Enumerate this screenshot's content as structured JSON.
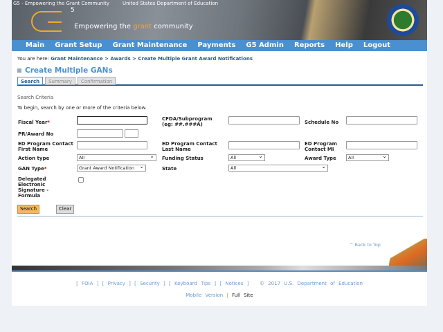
{
  "header": {
    "logo_alt": "G5 - Empowering the Grant Community",
    "ed_alt": "United States Department of Education",
    "tagline_pre": "Empowering the ",
    "tagline_accent": "grant",
    "tagline_post": " community",
    "g5_sup": "5"
  },
  "nav": [
    "Main",
    "Grant Setup",
    "Grant Maintenance",
    "Payments",
    "G5 Admin",
    "Reports",
    "Help",
    "Logout"
  ],
  "breadcrumb": {
    "prefix": "You are here: ",
    "path": "Grant Maintenance > Awards > Create Multiple Grant Award Notifications"
  },
  "title": "Create Multiple GANs",
  "tabs": [
    "Search",
    "Summary",
    "Confirmation"
  ],
  "form": {
    "section": "Search Criteria",
    "intro": "To begin, search by one or more of the criteria below.",
    "fiscal_year": "Fiscal Year",
    "cfda": "CFDA/Subprogram",
    "cfda_hint": "(eg: ##.###A)",
    "schedule": "Schedule No",
    "pr_award": "PR/Award No",
    "first_name": "ED Program Contact First Name",
    "last_name": "ED Program Contact Last Name",
    "mi": "ED Program Contact MI",
    "action_type": "Action type",
    "action_value": "All",
    "funding_status": "Funding Status",
    "funding_value": "All",
    "award_type": "Award Type",
    "award_value": "All",
    "gan_type": "GAN Type",
    "gan_value": "Grant Award Notification",
    "state": "State",
    "state_value": "All",
    "delegated": "Delegated Electronic Signature - Formula",
    "required": "*",
    "search_btn": "Search",
    "clear_btn": "Clear"
  },
  "back_to_top": "^ Back to Top",
  "footer": {
    "links": [
      "FOIA",
      "Privacy",
      "Security",
      "Keyboard Tips",
      "Notices"
    ],
    "copyright": "© 2017 U.S. Department of Education",
    "mobile": "Mobile Version",
    "sep": "|",
    "full": "Full Site"
  },
  "colors": {
    "nav": "#4a8fd0",
    "accent": "#f0a830",
    "title": "#4a8fd0"
  }
}
